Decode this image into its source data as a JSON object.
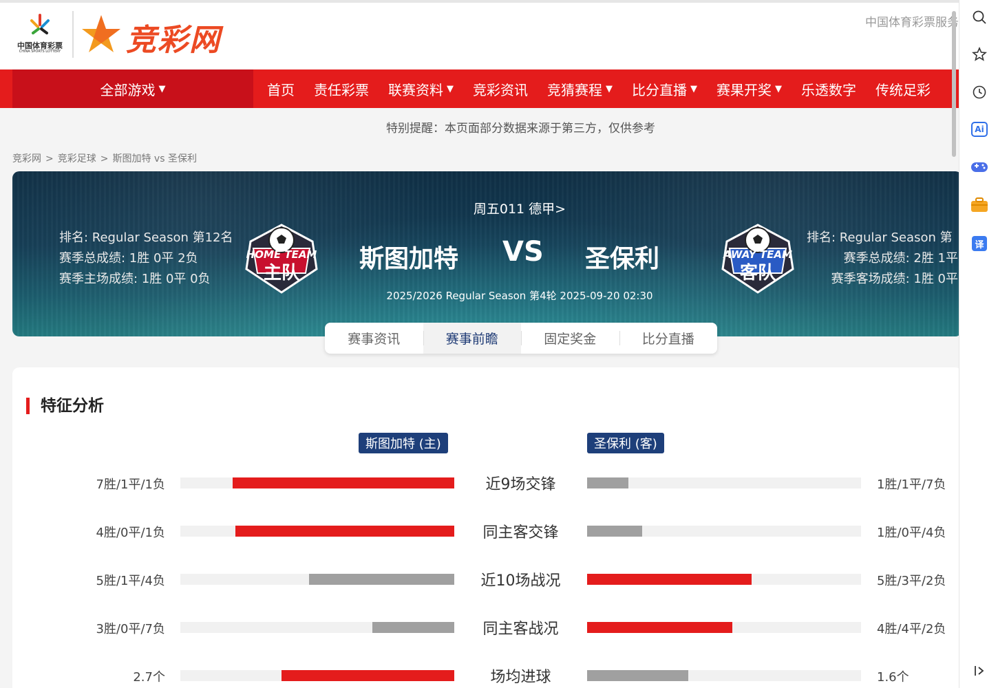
{
  "header": {
    "lottery_name": "中国体育彩票",
    "lottery_sub": "CHINA SPORTS LOTTERY",
    "site_logo_text": "竞彩网",
    "service_link": "中国体育彩票服务"
  },
  "nav": {
    "all_games": "全部游戏",
    "items": [
      {
        "label": "首页"
      },
      {
        "label": "责任彩票"
      },
      {
        "label": "联赛资料"
      },
      {
        "label": "竞彩资讯"
      },
      {
        "label": "竞猜赛程"
      },
      {
        "label": "比分直播"
      },
      {
        "label": "赛果开奖"
      },
      {
        "label": "乐透数字"
      },
      {
        "label": "传统足彩"
      }
    ]
  },
  "notice": "特别提醒：本页面部分数据来源于第三方，仅供参考",
  "breadcrumb": [
    "竞彩网",
    ">",
    "竞彩足球",
    ">",
    "斯图加特 vs 圣保利"
  ],
  "match": {
    "league_link": "周五011 德甲>",
    "home": {
      "name": "斯图加特",
      "rank": "排名: Regular Season 第12名",
      "season_record": "赛季总成绩: 1胜 0平 2负",
      "venue_record": "赛季主场成绩: 1胜 0平 0负",
      "badge_top": "HOME TEAM",
      "badge_main": "主队"
    },
    "away": {
      "name": "圣保利",
      "rank": "排名: Regular Season 第",
      "season_record": "赛季总成绩: 2胜 1平",
      "venue_record": "赛季客场成绩: 1胜 0平",
      "badge_top": "AWAY TEAM",
      "badge_main": "客队"
    },
    "vs": "VS",
    "season_line": "2025/2026 Regular Season 第4轮 2025-09-20 02:30"
  },
  "tabs": [
    {
      "label": "赛事资讯"
    },
    {
      "label": "赛事前瞻"
    },
    {
      "label": "固定奖金"
    },
    {
      "label": "比分直播"
    }
  ],
  "analysis": {
    "title": "特征分析",
    "home_tag": "斯图加特 (主)",
    "away_tag": "圣保利 (客)",
    "rows": [
      {
        "label": "近9场交锋",
        "home_value": "7胜/1平/1负",
        "away_value": "1胜/1平/7负",
        "home_fill": 0.81,
        "away_fill": 0.15,
        "home_color": "#e41c1c",
        "away_color": "#a0a0a0"
      },
      {
        "label": "同主客交锋",
        "home_value": "4胜/0平/1负",
        "away_value": "1胜/0平/4负",
        "home_fill": 0.8,
        "away_fill": 0.2,
        "home_color": "#e41c1c",
        "away_color": "#a0a0a0"
      },
      {
        "label": "近10场战况",
        "home_value": "5胜/1平/4负",
        "away_value": "5胜/3平/2负",
        "home_fill": 0.53,
        "away_fill": 0.6,
        "home_color": "#a0a0a0",
        "away_color": "#e41c1c"
      },
      {
        "label": "同主客战况",
        "home_value": "3胜/0平/7负",
        "away_value": "4胜/4平/2负",
        "home_fill": 0.3,
        "away_fill": 0.53,
        "home_color": "#a0a0a0",
        "away_color": "#e41c1c"
      },
      {
        "label": "场均进球",
        "home_value": "2.7个",
        "away_value": "1.6个",
        "home_fill": 0.63,
        "away_fill": 0.37,
        "home_color": "#e41c1c",
        "away_color": "#a0a0a0"
      }
    ]
  },
  "sidebar": {
    "icons": [
      "search-icon",
      "star-icon",
      "history-icon",
      "ai-icon",
      "gamepad-icon",
      "toolbox-icon",
      "translate-icon",
      "collapse-icon"
    ],
    "ai_text": "Ai",
    "translate_text": "译"
  }
}
